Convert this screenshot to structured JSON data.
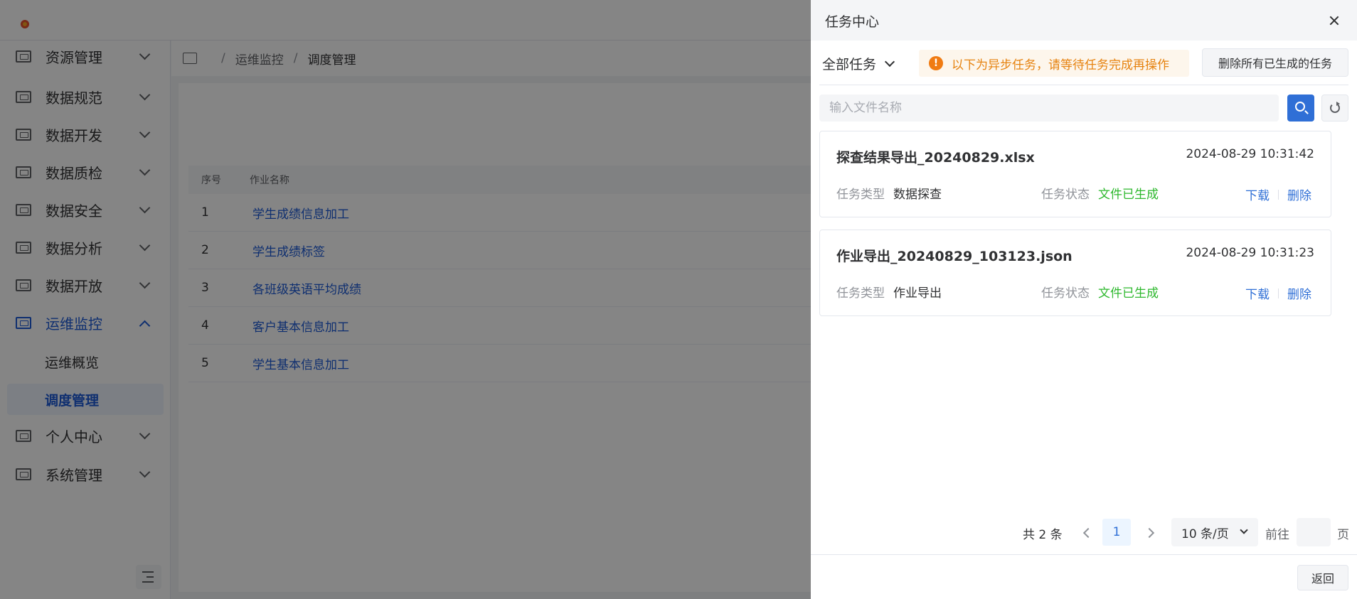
{
  "sidebar": {
    "items": [
      {
        "label": "资源管理",
        "icon": "server-icon"
      },
      {
        "label": "数据规范",
        "icon": "standard-icon"
      },
      {
        "label": "数据开发",
        "icon": "code-icon"
      },
      {
        "label": "数据质检",
        "icon": "inspect-icon"
      },
      {
        "label": "数据安全",
        "icon": "shield-icon"
      },
      {
        "label": "数据分析",
        "icon": "analysis-icon"
      },
      {
        "label": "数据开放",
        "icon": "open-icon"
      },
      {
        "label": "运维监控",
        "icon": "monitor-icon"
      },
      {
        "label": "个人中心",
        "icon": "user-icon"
      },
      {
        "label": "系统管理",
        "icon": "settings-icon"
      }
    ],
    "sub_items": [
      {
        "label": "运维概览"
      },
      {
        "label": "调度管理"
      }
    ]
  },
  "breadcrumb": {
    "items": [
      "运维监控",
      "调度管理"
    ],
    "separator": "/"
  },
  "table": {
    "headers": [
      "序号",
      "作业名称"
    ],
    "rows": [
      {
        "idx": "1",
        "name": "学生成绩信息加工"
      },
      {
        "idx": "2",
        "name": "学生成绩标签"
      },
      {
        "idx": "3",
        "name": "各班级英语平均成绩"
      },
      {
        "idx": "4",
        "name": "客户基本信息加工"
      },
      {
        "idx": "5",
        "name": "学生基本信息加工"
      }
    ]
  },
  "drawer": {
    "title": "任务中心",
    "type_select": "全部任务",
    "alert_icon_glyph": "!",
    "alert": "以下为异步任务，请等待任务完成再操作",
    "delete_all_label": "删除所有已生成的任务",
    "search_placeholder": "输入文件名称",
    "search_value": "",
    "tasks": [
      {
        "name": "探查结果导出_20240829.xlsx",
        "time": "2024-08-29 10:31:42",
        "type_label": "任务类型",
        "type": "数据探查",
        "status_label": "任务状态",
        "status": "文件已生成",
        "download": "下载",
        "delete": "删除"
      },
      {
        "name": "作业导出_20240829_103123.json",
        "time": "2024-08-29 10:31:23",
        "type_label": "任务类型",
        "type": "作业导出",
        "status_label": "任务状态",
        "status": "文件已生成",
        "download": "下载",
        "delete": "删除"
      }
    ],
    "pager": {
      "total": "共 2 条",
      "current": "1",
      "page_size": "10 条/页",
      "goto_label": "前往",
      "goto_value": "",
      "goto_suffix": "页"
    },
    "back_label": "返回"
  },
  "colors": {
    "primary": "#2f6fd6",
    "success": "#2eb82e",
    "warning": "#e6820f",
    "overlay": "rgba(0,0,0,0.48)"
  }
}
